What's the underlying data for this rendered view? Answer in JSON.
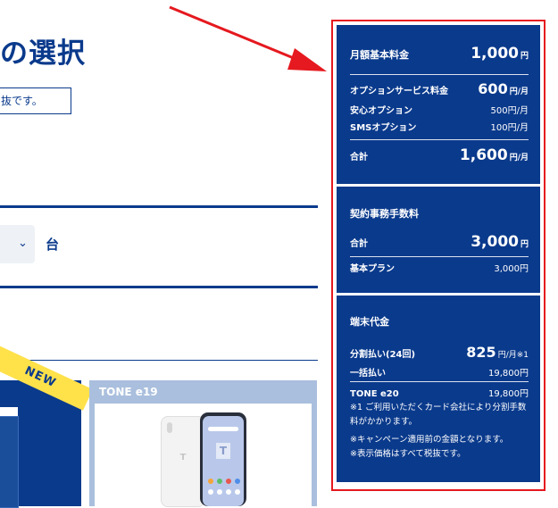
{
  "page": {
    "heading": "の選択",
    "note_box_text": "抜です。",
    "quantity_unit": "台"
  },
  "products": {
    "new_badge": "NEW",
    "card2_title": "TONE e19"
  },
  "summary": {
    "monthly": {
      "label": "月額基本料金",
      "value": "1,000",
      "unit": "円",
      "options_label": "オプションサービス料金",
      "options_value": "600",
      "options_unit": "円/月",
      "items": [
        {
          "label": "安心オプション",
          "value": "500円/月"
        },
        {
          "label": "SMSオプション",
          "value": "100円/月"
        }
      ],
      "total_label": "合計",
      "total_value": "1,600",
      "total_unit": "円/月"
    },
    "contract": {
      "title": "契約事務手数料",
      "total_label": "合計",
      "total_value": "3,000",
      "total_unit": "円",
      "plan_label": "基本プラン",
      "plan_value": "3,000円"
    },
    "device": {
      "title": "端末代金",
      "installment_label": "分割払い(24回)",
      "installment_value": "825",
      "installment_unit": "円/月※1",
      "lump_label": "一括払い",
      "lump_value": "19,800円",
      "model_label": "TONE e20",
      "model_value": "19,800円",
      "notes": [
        "※1 ご利用いただくカード会社により分割手数料がかかります。",
        "※キャンペーン適用前の金額となります。",
        "※表示価格はすべて税抜です。"
      ]
    }
  },
  "colors": {
    "brand": "#0a3a8c",
    "highlight_border": "#e5191f",
    "arrow": "#e5191f",
    "badge": "#ffe14a"
  }
}
